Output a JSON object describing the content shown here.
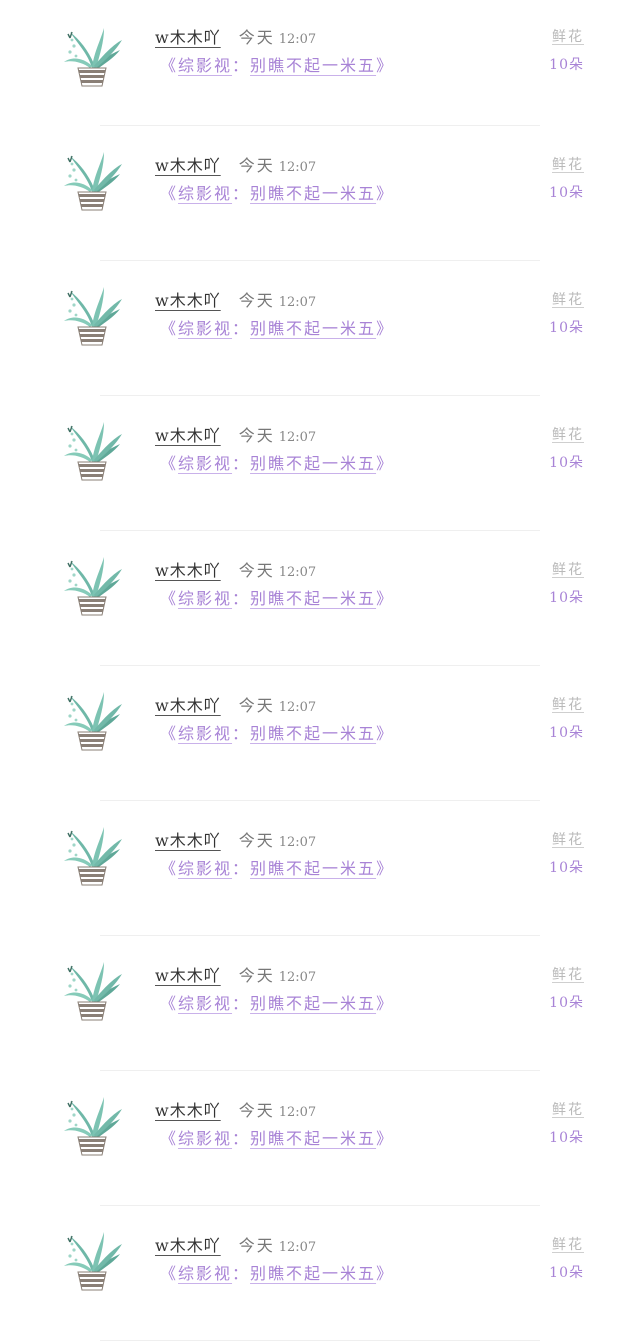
{
  "gift_feed": {
    "items": [
      {
        "user": "w木木吖",
        "day": "今天",
        "time": "12:07",
        "open": "《",
        "work": "综影视",
        "sep": "：",
        "title": "别瞧不起一米五",
        "close": "》",
        "gift_label": "鲜花",
        "gift_count": "10朵"
      },
      {
        "user": "w木木吖",
        "day": "今天",
        "time": "12:07",
        "open": "《",
        "work": "综影视",
        "sep": "：",
        "title": "别瞧不起一米五",
        "close": "》",
        "gift_label": "鲜花",
        "gift_count": "10朵"
      },
      {
        "user": "w木木吖",
        "day": "今天",
        "time": "12:07",
        "open": "《",
        "work": "综影视",
        "sep": "：",
        "title": "别瞧不起一米五",
        "close": "》",
        "gift_label": "鲜花",
        "gift_count": "10朵"
      },
      {
        "user": "w木木吖",
        "day": "今天",
        "time": "12:07",
        "open": "《",
        "work": "综影视",
        "sep": "：",
        "title": "别瞧不起一米五",
        "close": "》",
        "gift_label": "鲜花",
        "gift_count": "10朵"
      },
      {
        "user": "w木木吖",
        "day": "今天",
        "time": "12:07",
        "open": "《",
        "work": "综影视",
        "sep": "：",
        "title": "别瞧不起一米五",
        "close": "》",
        "gift_label": "鲜花",
        "gift_count": "10朵"
      },
      {
        "user": "w木木吖",
        "day": "今天",
        "time": "12:07",
        "open": "《",
        "work": "综影视",
        "sep": "：",
        "title": "别瞧不起一米五",
        "close": "》",
        "gift_label": "鲜花",
        "gift_count": "10朵"
      },
      {
        "user": "w木木吖",
        "day": "今天",
        "time": "12:07",
        "open": "《",
        "work": "综影视",
        "sep": "：",
        "title": "别瞧不起一米五",
        "close": "》",
        "gift_label": "鲜花",
        "gift_count": "10朵"
      },
      {
        "user": "w木木吖",
        "day": "今天",
        "time": "12:07",
        "open": "《",
        "work": "综影视",
        "sep": "：",
        "title": "别瞧不起一米五",
        "close": "》",
        "gift_label": "鲜花",
        "gift_count": "10朵"
      },
      {
        "user": "w木木吖",
        "day": "今天",
        "time": "12:07",
        "open": "《",
        "work": "综影视",
        "sep": "：",
        "title": "别瞧不起一米五",
        "close": "》",
        "gift_label": "鲜花",
        "gift_count": "10朵"
      },
      {
        "user": "w木木吖",
        "day": "今天",
        "time": "12:07",
        "open": "《",
        "work": "综影视",
        "sep": "：",
        "title": "别瞧不起一米五",
        "close": "》",
        "gift_label": "鲜花",
        "gift_count": "10朵"
      }
    ],
    "avatar_icon": "potted-plant-icon",
    "colors": {
      "accent": "#a883d6",
      "plant": "#6fb8a8",
      "pot": "#8a7f76",
      "muted": "#b9b9b9"
    }
  }
}
